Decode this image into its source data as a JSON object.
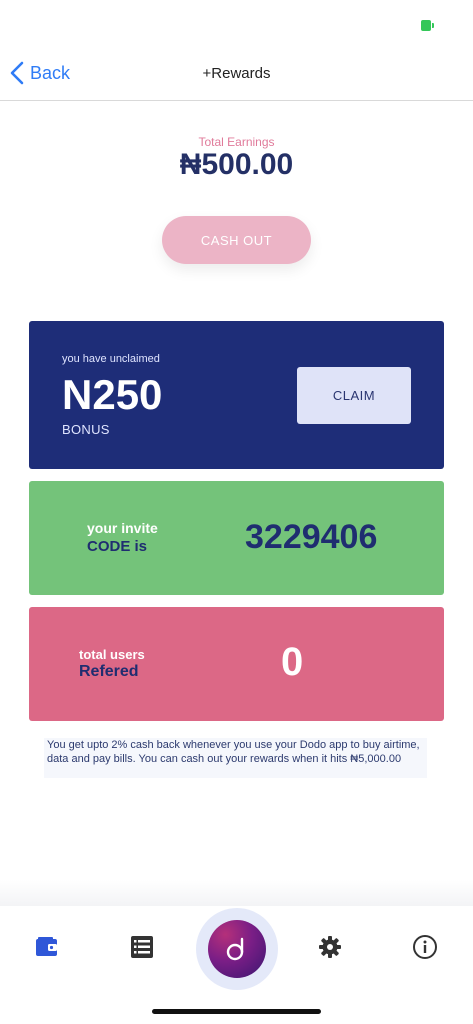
{
  "nav": {
    "back_label": "Back",
    "title": "+Rewards"
  },
  "earnings": {
    "label": "Total Earnings",
    "amount": "₦500.00",
    "cashout_label": "CASH OUT"
  },
  "bonus_card": {
    "caption": "you have unclaimed",
    "amount": "N250",
    "label": "BONUS",
    "claim_label": "CLAIM",
    "color": "#1e2d78"
  },
  "invite_card": {
    "line1": "your invite",
    "line2": "CODE is",
    "code": "3229406",
    "color": "#74c37a"
  },
  "referred_card": {
    "line1": "total users",
    "line2": "Refered",
    "count": "0",
    "color": "#dc6886"
  },
  "info_text": "You get upto 2% cash back whenever you use your Dodo app to buy airtime, data and pay bills. You can cash out your rewards when it hits ₦5,000.00",
  "tab_bar": {
    "items": [
      "wallet-icon",
      "list-icon",
      "dodo-logo-icon",
      "gear-icon",
      "info-icon"
    ],
    "active": "wallet-icon",
    "accent": "#2f57d8"
  }
}
